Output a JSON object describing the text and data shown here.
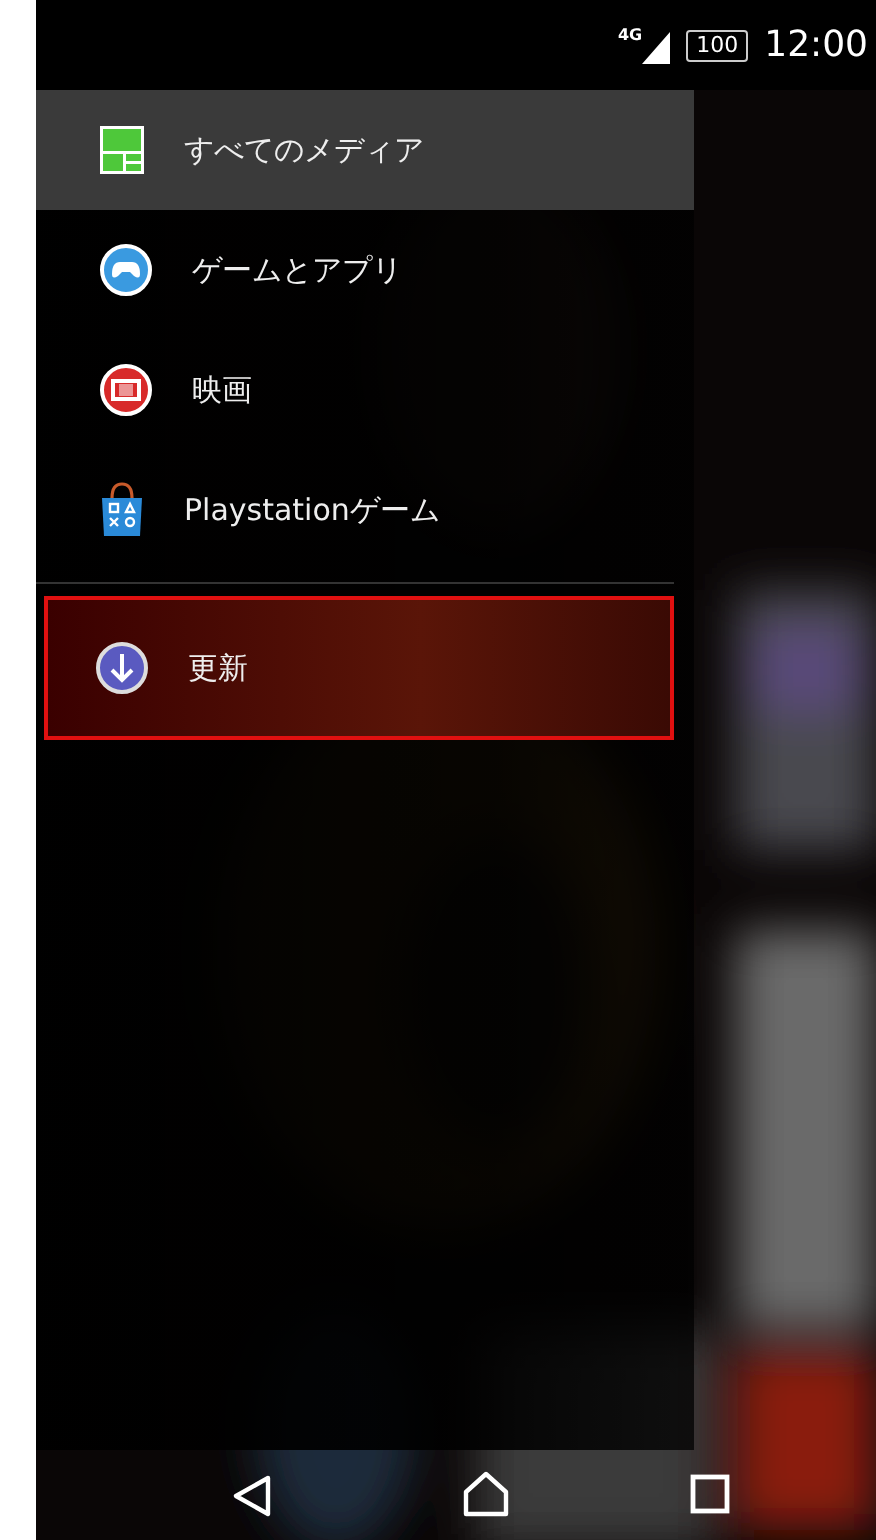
{
  "status_bar": {
    "network": "4G",
    "battery": "100",
    "time": "12:00"
  },
  "drawer": {
    "groups": [
      {
        "items": [
          {
            "label": "すべてのメディア",
            "kind": "grid",
            "selected": true,
            "focused": false
          },
          {
            "label": "ゲームとアプリ",
            "kind": "gamepad",
            "selected": false,
            "focused": false
          },
          {
            "label": "映画",
            "kind": "film",
            "selected": false,
            "focused": false
          },
          {
            "label": "Playstationゲーム",
            "kind": "bag",
            "selected": false,
            "focused": false
          }
        ]
      },
      {
        "items": [
          {
            "label": "更新",
            "kind": "download",
            "selected": false,
            "focused": true
          }
        ]
      }
    ]
  }
}
